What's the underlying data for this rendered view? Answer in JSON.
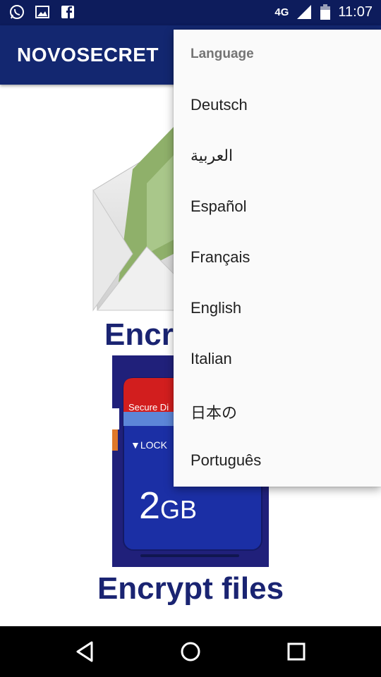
{
  "status_bar": {
    "network": "4G",
    "time": "11:07",
    "icons": [
      "whatsapp-icon",
      "image-icon",
      "facebook-icon",
      "signal-icon",
      "battery-icon"
    ]
  },
  "app_bar": {
    "title": "NOVOSECRET"
  },
  "main": {
    "encrypt_message_label": "Encry",
    "sd_card": {
      "brand": "Secure Di",
      "lock": "▼LOCK",
      "capacity_number": "2",
      "capacity_unit": "GB"
    },
    "encrypt_files_label": "Encrypt files"
  },
  "language_menu": {
    "header": "Language",
    "items": [
      "Deutsch",
      "العربية",
      "Español",
      "Français",
      "English",
      "Italian",
      "日本の",
      "Português"
    ]
  },
  "colors": {
    "status_bar": "#0d1c5c",
    "app_bar": "#132770",
    "label_text": "#1a2472",
    "menu_bg": "#fafafa"
  }
}
